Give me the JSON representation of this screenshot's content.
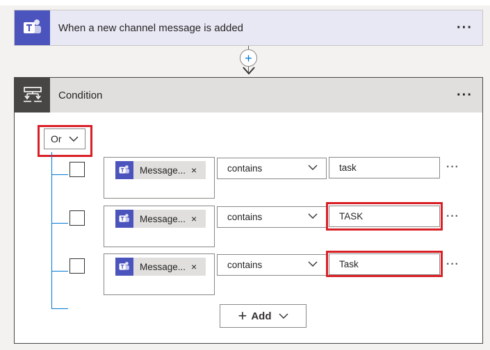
{
  "trigger": {
    "title": "When a new channel message is added",
    "icon": "teams-icon",
    "more": "···"
  },
  "connector": {
    "plus": "+"
  },
  "condition": {
    "title": "Condition",
    "icon": "condition-icon",
    "more": "···",
    "group_operator": "Or",
    "rows": [
      {
        "token": "Message...",
        "remove": "×",
        "operator": "contains",
        "value": "task",
        "more": "···"
      },
      {
        "token": "Message...",
        "remove": "×",
        "operator": "contains",
        "value": "TASK",
        "more": "···"
      },
      {
        "token": "Message...",
        "remove": "×",
        "operator": "contains",
        "value": "Task",
        "more": "···"
      }
    ],
    "add_label": "Add"
  },
  "colors": {
    "teams_purple": "#4b53bc",
    "highlight_red": "#d91f26",
    "tree_blue": "#0078d4"
  }
}
